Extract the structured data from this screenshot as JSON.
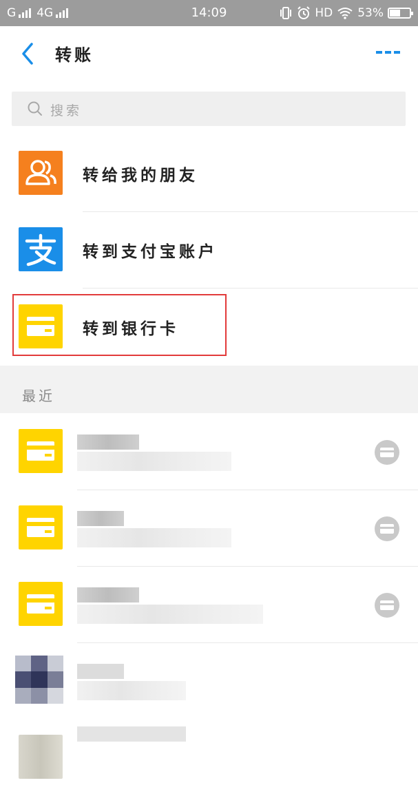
{
  "status_bar": {
    "carrier": "G",
    "network": "4G",
    "time": "14:09",
    "hd": "HD",
    "battery": "53%",
    "battery_level": 0.53
  },
  "header": {
    "title": "转账",
    "back_icon": "chevron-left-icon",
    "more_icon": "more-dots-icon"
  },
  "search": {
    "placeholder": "搜索",
    "icon": "search-icon"
  },
  "options": [
    {
      "label": "转给我的朋友",
      "icon": "friends-icon",
      "color": "#f5801e"
    },
    {
      "label": "转到支付宝账户",
      "icon": "alipay-icon",
      "color": "#1a8ee8"
    },
    {
      "label": "转到银行卡",
      "icon": "bank-card-icon",
      "color": "#ffd400"
    }
  ],
  "recent": {
    "section_label": "最近"
  },
  "colors": {
    "accent": "#1a8ee8",
    "highlight": "#e23a3a",
    "card_yellow": "#ffd400"
  }
}
